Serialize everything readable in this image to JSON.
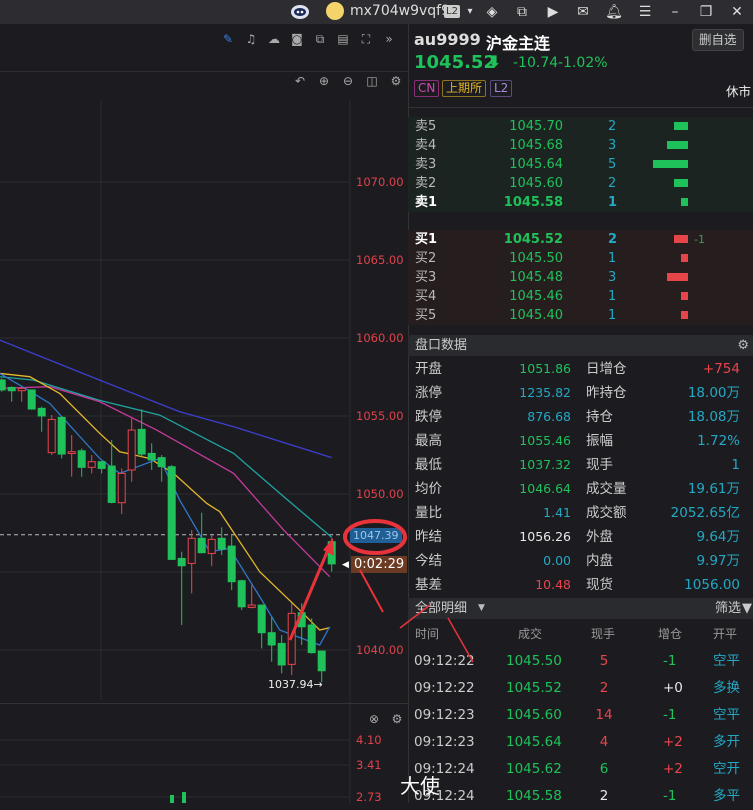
{
  "titlebar": {
    "username": "mx704w9vqf9",
    "level_badge": "L2"
  },
  "chart": {
    "y_axis_labels": [
      "1070.00",
      "1065.00",
      "1060.00",
      "1055.00",
      "1050.00",
      "1040.00"
    ],
    "y_axis_values": [
      1070,
      1065,
      1060,
      1055,
      1050,
      1040
    ],
    "grid_levels": [
      1070,
      1065,
      1060,
      1055,
      1050,
      1045,
      1040
    ],
    "current_price_tag": "1047.39",
    "current_price_value": 1047.39,
    "countdown": "0:02:29",
    "low_marker": "1037.94→",
    "low_value": 1037.94,
    "candles": [
      [
        1057.31,
        1056.67,
        1057.41,
        1056.56
      ],
      [
        1056.83,
        1056.62,
        1056.9,
        1055.92
      ],
      [
        1056.62,
        1056.77,
        1056.85,
        1055.92
      ],
      [
        1056.67,
        1055.45,
        1056.7,
        1055.4
      ],
      [
        1055.49,
        1055.0,
        1055.6,
        1053.99
      ],
      [
        1052.65,
        1054.78,
        1055.06,
        1052.5
      ],
      [
        1054.91,
        1052.56,
        1055.0,
        1052.28
      ],
      [
        1052.6,
        1052.71,
        1053.78,
        1051.11
      ],
      [
        1052.77,
        1051.71,
        1052.92,
        1051.11
      ],
      [
        1051.71,
        1052.07,
        1052.5,
        1051.32
      ],
      [
        1052.07,
        1051.64,
        1052.1,
        1051.32
      ],
      [
        1051.79,
        1049.46,
        1053.46,
        1049.4
      ],
      [
        1049.44,
        1051.32,
        1051.64,
        1048.72
      ],
      [
        1051.54,
        1054.1,
        1054.85,
        1050.79
      ],
      [
        1054.14,
        1052.56,
        1055.42,
        1052.39
      ],
      [
        1052.6,
        1052.18,
        1053.25,
        1051.54
      ],
      [
        1052.33,
        1051.75,
        1052.5,
        1050.79
      ],
      [
        1051.75,
        1045.81,
        1051.86,
        1045.77
      ],
      [
        1045.87,
        1045.4,
        1046.3,
        1041.6
      ],
      [
        1045.55,
        1047.16,
        1047.69,
        1043.63
      ],
      [
        1047.16,
        1046.24,
        1048.8,
        1046.19
      ],
      [
        1046.19,
        1047.09,
        1047.37,
        1045.38
      ],
      [
        1047.16,
        1046.47,
        1047.86,
        1046.09
      ],
      [
        1046.66,
        1044.38,
        1047.37,
        1043.84
      ],
      [
        1044.44,
        1042.77,
        1044.5,
        1042.56
      ],
      [
        1042.73,
        1042.88,
        1044.16,
        1042.67
      ],
      [
        1042.88,
        1041.11,
        1042.9,
        1040.1
      ],
      [
        1041.11,
        1040.32,
        1042.13,
        1039.25
      ],
      [
        1040.42,
        1039.04,
        1040.96,
        1038.5
      ],
      [
        1039.08,
        1042.35,
        1042.99,
        1038.39
      ],
      [
        1042.39,
        1041.49,
        1042.99,
        1040.32
      ],
      [
        1041.6,
        1039.83,
        1042.03,
        1039.78
      ],
      [
        1039.93,
        1038.67,
        1039.95,
        1037.94
      ],
      [
        1046.94,
        1045.52,
        1047.16,
        1045.02
      ]
    ],
    "ma_lines": [
      {
        "color": "#3c3fd0",
        "points": [
          [
            -0.2,
            1059.87
          ],
          [
            9.8,
            1057.3
          ],
          [
            17.8,
            1055.27
          ],
          [
            23.2,
            1054.31
          ],
          [
            33,
            1052.33
          ]
        ]
      },
      {
        "color": "#1fa3a0",
        "points": [
          [
            -0.2,
            1057.52
          ],
          [
            3.2,
            1057.3
          ],
          [
            9.8,
            1056.0
          ],
          [
            15.8,
            1055.06
          ],
          [
            23.2,
            1052.6
          ],
          [
            28.2,
            1049.83
          ],
          [
            33,
            1047.22
          ]
        ]
      },
      {
        "color": "#c43a9c",
        "points": [
          [
            -0.2,
            1056.77
          ],
          [
            4.8,
            1056.88
          ],
          [
            9.8,
            1055.92
          ],
          [
            15.5,
            1054.1
          ],
          [
            23.2,
            1051.32
          ],
          [
            28.2,
            1047.69
          ],
          [
            32.8,
            1044.7
          ]
        ]
      },
      {
        "color": "#e5b72a",
        "points": [
          [
            -0.2,
            1057.73
          ],
          [
            2.8,
            1057.52
          ],
          [
            5.8,
            1056.45
          ],
          [
            9.8,
            1053.89
          ],
          [
            11.8,
            1052.71
          ],
          [
            14.8,
            1052.28
          ],
          [
            17.2,
            1051.32
          ],
          [
            20.5,
            1049.4
          ],
          [
            21.8,
            1048.87
          ],
          [
            25.8,
            1045.02
          ],
          [
            29.8,
            1042.56
          ],
          [
            31.8,
            1041.28
          ],
          [
            32.8,
            1041.43
          ]
        ]
      },
      {
        "color": "#2f78c8",
        "points": [
          [
            -0.2,
            1057.73
          ],
          [
            1.8,
            1056.98
          ],
          [
            4.8,
            1055.81
          ],
          [
            9.8,
            1052.28
          ],
          [
            11.8,
            1051.32
          ],
          [
            15.8,
            1052.28
          ],
          [
            17.8,
            1049.61
          ],
          [
            20.8,
            1046.3
          ],
          [
            22.8,
            1046.51
          ],
          [
            25.8,
            1043.42
          ],
          [
            27.8,
            1041.28
          ],
          [
            31.8,
            1040.32
          ],
          [
            32.8,
            1041.49
          ]
        ]
      }
    ],
    "sub_axis_labels": [
      "4.10",
      "3.41",
      "2.73"
    ]
  },
  "quote": {
    "code": "au9999",
    "name": "沪金主连",
    "remove_watch": "删自选",
    "price": "1045.52",
    "change": "-10.74",
    "change_pct": "-1.02%",
    "badges": [
      "CN",
      "上期所",
      "L2"
    ],
    "status": "休市"
  },
  "orderbook": {
    "asks": [
      {
        "label": "卖5",
        "price": "1045.70",
        "vol": "2",
        "qty": 2
      },
      {
        "label": "卖4",
        "price": "1045.68",
        "vol": "3",
        "qty": 3
      },
      {
        "label": "卖3",
        "price": "1045.64",
        "vol": "5",
        "qty": 5
      },
      {
        "label": "卖2",
        "price": "1045.60",
        "vol": "2",
        "qty": 2
      },
      {
        "label": "卖1",
        "price": "1045.58",
        "vol": "1",
        "qty": 1
      }
    ],
    "bids": [
      {
        "label": "买1",
        "price": "1045.52",
        "vol": "2",
        "qty": 2,
        "delta": "-1"
      },
      {
        "label": "买2",
        "price": "1045.50",
        "vol": "1",
        "qty": 1
      },
      {
        "label": "买3",
        "price": "1045.48",
        "vol": "3",
        "qty": 3
      },
      {
        "label": "买4",
        "price": "1045.46",
        "vol": "1",
        "qty": 1
      },
      {
        "label": "买5",
        "price": "1045.40",
        "vol": "1",
        "qty": 1
      }
    ]
  },
  "stats": {
    "title": "盘口数据",
    "rows": [
      {
        "l1": "开盘",
        "v1": "1051.86",
        "c1": "green",
        "l2": "日增仓",
        "v2": "+754",
        "c2": "red"
      },
      {
        "l1": "涨停",
        "v1": "1235.82",
        "c1": "cyan",
        "l2": "昨持仓",
        "v2": "18.00万",
        "c2": "cyan"
      },
      {
        "l1": "跌停",
        "v1": "876.68",
        "c1": "cyan",
        "l2": "持仓",
        "v2": "18.08万",
        "c2": "cyan"
      },
      {
        "l1": "最高",
        "v1": "1055.46",
        "c1": "green",
        "l2": "振幅",
        "v2": "1.72%",
        "c2": "cyan"
      },
      {
        "l1": "最低",
        "v1": "1037.32",
        "c1": "green",
        "l2": "现手",
        "v2": "1",
        "c2": "cyan"
      },
      {
        "l1": "均价",
        "v1": "1046.64",
        "c1": "green",
        "l2": "成交量",
        "v2": "19.61万",
        "c2": "cyan"
      },
      {
        "l1": "量比",
        "v1": "1.41",
        "c1": "cyan",
        "l2": "成交额",
        "v2": "2052.65亿",
        "c2": "cyan"
      },
      {
        "l1": "昨结",
        "v1": "1056.26",
        "c1": "white",
        "l2": "外盘",
        "v2": "9.64万",
        "c2": "cyan"
      },
      {
        "l1": "今结",
        "v1": "0.00",
        "c1": "cyan",
        "l2": "内盘",
        "v2": "9.97万",
        "c2": "cyan"
      },
      {
        "l1": "基差",
        "v1": "10.48",
        "c1": "red",
        "l2": "现货",
        "v2": "1056.00",
        "c2": "cyan"
      }
    ]
  },
  "trades": {
    "title": "全部明细",
    "filter": "筛选",
    "headers": [
      "时间",
      "成交",
      "现手",
      "增仓",
      "开平"
    ],
    "rows": [
      {
        "time": "09:12:22",
        "price": "1045.50",
        "vol": "5",
        "vc": "red",
        "oi": "-1",
        "oc": "green",
        "type": "空平"
      },
      {
        "time": "09:12:22",
        "price": "1045.52",
        "vol": "2",
        "vc": "red",
        "oi": "+0",
        "oc": "white",
        "type": "多换"
      },
      {
        "time": "09:12:23",
        "price": "1045.60",
        "vol": "14",
        "vc": "red",
        "oi": "-1",
        "oc": "green",
        "type": "空平"
      },
      {
        "time": "09:12:23",
        "price": "1045.64",
        "vol": "4",
        "vc": "red",
        "oi": "+2",
        "oc": "red",
        "type": "多开"
      },
      {
        "time": "09:12:24",
        "price": "1045.62",
        "vol": "6",
        "vc": "green",
        "oi": "+2",
        "oc": "red",
        "type": "空开"
      },
      {
        "time": "09:12:24",
        "price": "1045.58",
        "vol": "2",
        "vc": "white",
        "oi": "-1",
        "oc": "green",
        "type": "多平"
      }
    ]
  },
  "watermark": "大使",
  "colors": {
    "up": "#e8454b",
    "down": "#1fc15a",
    "annotation": "#e8333a"
  }
}
